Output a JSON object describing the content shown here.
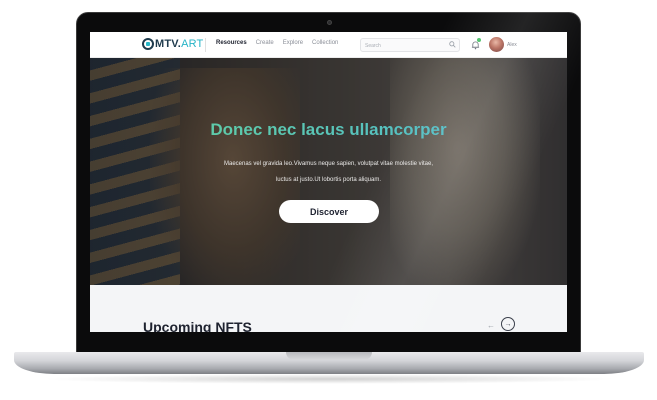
{
  "brand": {
    "logo_main": "MTV.",
    "logo_accent": "ART"
  },
  "nav": {
    "links": [
      {
        "label": "Resources",
        "active": true
      },
      {
        "label": "Create",
        "active": false
      },
      {
        "label": "Explore",
        "active": false
      },
      {
        "label": "Collection",
        "active": false
      }
    ],
    "search_placeholder": "Search",
    "icons": {
      "search": "search-icon",
      "notifications": "bell-icon"
    },
    "notification_dot_color": "#4cc26a",
    "user_name": "Alex"
  },
  "hero": {
    "title": "Donec nec lacus ullamcorper",
    "description_line1": "Maecenas vel gravida leo.Vivamus neque sapien, volutpat vitae molestie vitae,",
    "description_line2": "luctus at justo.Ut lobortis porta aliquam.",
    "button_label": "Discover",
    "title_gradient": [
      "#63d19a",
      "#4fb8d6"
    ]
  },
  "upcoming": {
    "title": "Upcoming NFTS",
    "prev_arrow": "←",
    "next_arrow": "→"
  }
}
